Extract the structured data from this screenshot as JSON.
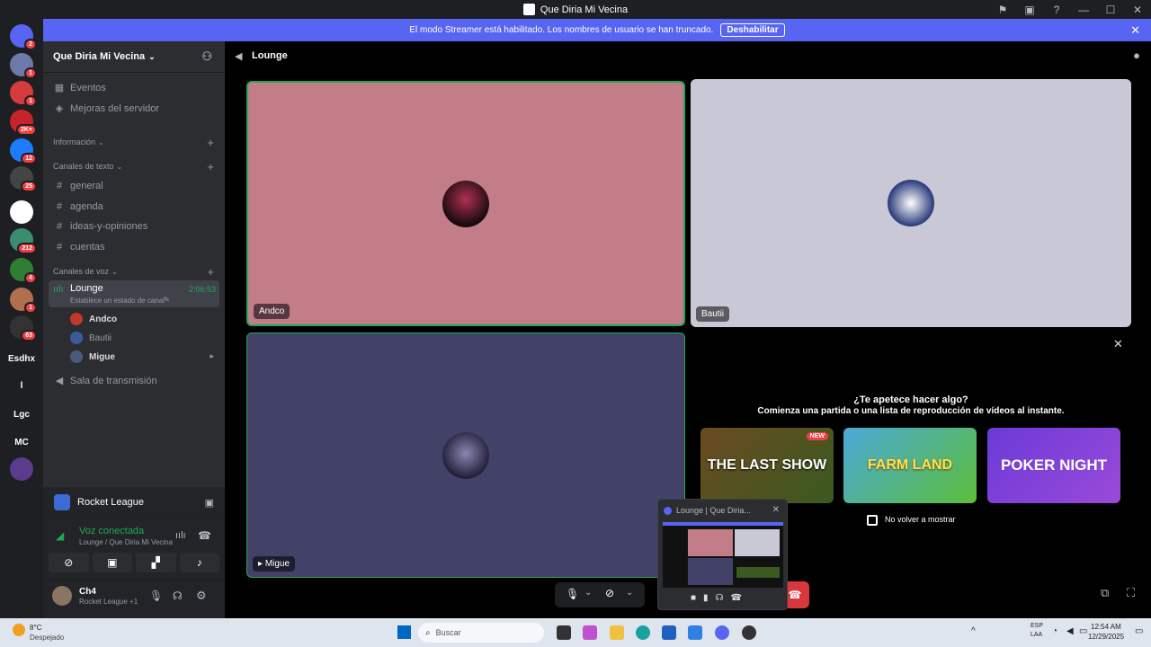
{
  "window": {
    "title": "Que Diria Mi Vecina"
  },
  "banner": {
    "text": "El modo Streamer está habilitado. Los nombres de usuario se han truncado.",
    "button": "Deshabilitar"
  },
  "servers": [
    {
      "label": "",
      "badge": "2",
      "color": "#5865f2"
    },
    {
      "label": "",
      "badge": "1",
      "color": "#6b7aa8"
    },
    {
      "label": "",
      "badge": "1",
      "color": "#d63c3c"
    },
    {
      "label": "",
      "badge": "2K+",
      "color": "#c8232c"
    },
    {
      "label": "",
      "badge": "12",
      "color": "#1e7bff"
    },
    {
      "label": "",
      "badge": "25",
      "color": "#444"
    },
    {
      "label": "",
      "badge": "",
      "color": "#fff"
    },
    {
      "label": "",
      "badge": "212",
      "color": "#3a8d6e"
    },
    {
      "label": "",
      "badge": "4",
      "color": "#2f7d32"
    },
    {
      "label": "",
      "badge": "1",
      "color": "#b07050"
    },
    {
      "label": "",
      "badge": "63",
      "color": "#333"
    },
    {
      "label": "Esdhx",
      "badge": "",
      "color": ""
    },
    {
      "label": "l",
      "badge": "",
      "color": ""
    },
    {
      "label": "Lgc",
      "badge": "",
      "color": ""
    },
    {
      "label": "MC",
      "badge": "",
      "color": ""
    },
    {
      "label": "",
      "badge": "",
      "color": "#5b3c8c"
    }
  ],
  "sidebar": {
    "server_name": "Que Diria Mi Vecina",
    "events": "Eventos",
    "boost": "Mejoras del servidor",
    "cat_info": "Información",
    "cat_text": "Canales de texto",
    "text_channels": [
      "general",
      "agenda",
      "ideas-y-opiniones",
      "cuentas"
    ],
    "cat_voice": "Canales de voz",
    "voice_channel": {
      "name": "Lounge",
      "time": "2:06:53",
      "status": "Establece un estado de canal"
    },
    "voice_users": [
      "Andco",
      "Bautii",
      "Migue"
    ],
    "stage": "Sala de transmisión"
  },
  "activity": {
    "name": "Rocket League"
  },
  "voice": {
    "status": "Voz conectada",
    "channel": "Lounge / Que Diria Mi Vecina"
  },
  "user": {
    "name": "Ch4",
    "sub": "Rocket League +1"
  },
  "main": {
    "channel": "Lounge",
    "tiles": [
      {
        "name": "Andco"
      },
      {
        "name": "Bautii"
      },
      {
        "name": "Migue"
      }
    ],
    "prompt_title": "¿Te apetece hacer algo?",
    "prompt_sub": "Comienza una partida o una lista de reproducción de vídeos al instante.",
    "games": [
      {
        "label": "THE LAST SHOW",
        "badge": "NEW"
      },
      {
        "label": "FARM LAND",
        "badge": ""
      },
      {
        "label": "POKER NIGHT",
        "badge": ""
      }
    ],
    "dont_show": "No volver a mostrar"
  },
  "popup": {
    "title": "Lounge | Que Diria..."
  },
  "taskbar": {
    "weather_temp": "8°C",
    "weather_desc": "Despejado",
    "search": "Buscar",
    "lang1": "ESP",
    "lang2": "LAA",
    "time": "12:54 AM",
    "date": "12/29/2025"
  }
}
